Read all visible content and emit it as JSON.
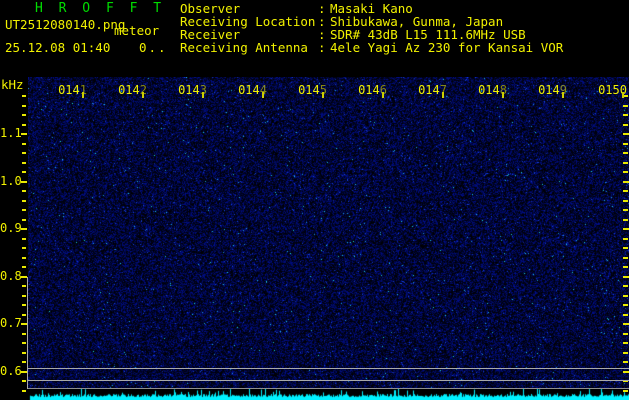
{
  "window": {
    "app_title": "H R O F F T"
  },
  "header": {
    "filename": "UT2512080140.png",
    "mode": "meteor",
    "datetime": "25.12.08 01:40",
    "counter": "0..",
    "info_separator": ":",
    "info_rows": [
      {
        "label": "Observer",
        "value": "Masaki Kano"
      },
      {
        "label": "Receiving Location",
        "value": "Shibukawa, Gunma, Japan"
      },
      {
        "label": "Receiver",
        "value": "SDR# 43dB L15 111.6MHz USB"
      },
      {
        "label": "Receiving Antenna",
        "value": "4ele Yagi Az 230 for Kansai VOR"
      }
    ]
  },
  "spectrogram": {
    "type": "heatmap",
    "description": "radio meteor echo waterfall, blue background noise only, no echoes visible",
    "y_axis": {
      "unit": "kHz",
      "labels": [
        "1.1",
        "1.0",
        "0.9",
        "0.8",
        "0.7",
        "0.6"
      ]
    },
    "x_axis": {
      "labels": [
        "0141",
        "0142",
        "0143",
        "0144",
        "0145",
        "0146",
        "0147",
        "0148",
        "0149",
        "0150"
      ]
    }
  },
  "colors": {
    "background": "#000000",
    "text_yellow": "#f2f200",
    "title_green": "#00dd00",
    "grid_grey": "#a9a9a9",
    "smeter_cyan": "#00f2ff",
    "noise_blue": "#0000c8"
  }
}
